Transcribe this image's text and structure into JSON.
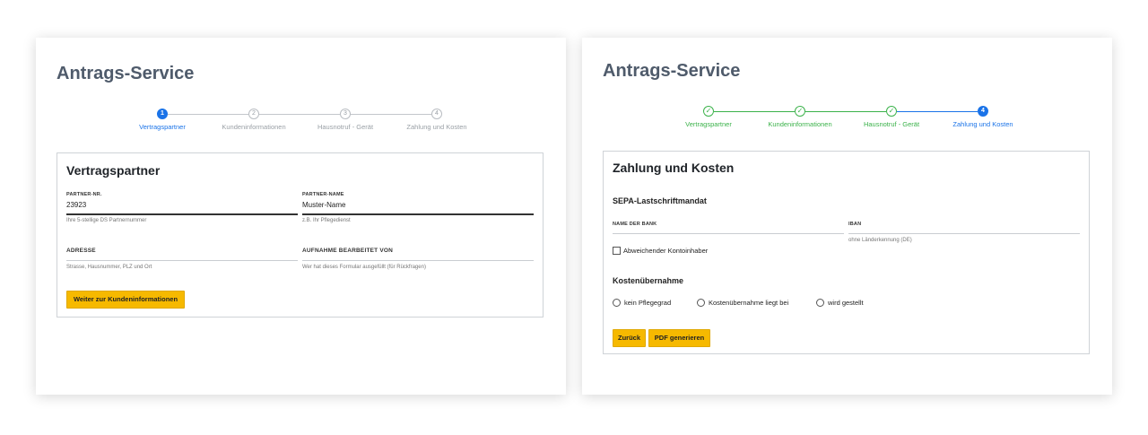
{
  "left_panel": {
    "title": "Antrags-Service",
    "steps": [
      {
        "number": "1",
        "label": "Vertragspartner",
        "state": "active"
      },
      {
        "number": "2",
        "label": "Kundeninformationen",
        "state": "pending"
      },
      {
        "number": "3",
        "label": "Hausnotruf - Gerät",
        "state": "pending"
      },
      {
        "number": "4",
        "label": "Zahlung und Kosten",
        "state": "pending"
      }
    ],
    "card_title": "Vertragspartner",
    "fields": {
      "partner_nr": {
        "label": "PARTNER-NR.",
        "value": "23923",
        "hint": "Ihre 5-stellige DS Partnernummer"
      },
      "partner_name": {
        "label": "PARTNER-NAME",
        "value": "Muster-Name",
        "hint": "z.B. Ihr Pflegedienst"
      },
      "adresse": {
        "label": "ADRESSE",
        "value": "",
        "hint": "Strasse, Hausnummer, PLZ und Ort"
      },
      "bearbeitet_von": {
        "label": "AUFNAHME BEARBEITET VON",
        "value": "",
        "hint": "Wer hat dieses Formular ausgefüllt (für Rückfragen)"
      }
    },
    "next_button": "Weiter zur Kundeninformationen"
  },
  "right_panel": {
    "title": "Antrags-Service",
    "steps": [
      {
        "number": "✓",
        "label": "Vertragspartner",
        "state": "done"
      },
      {
        "number": "✓",
        "label": "Kundeninformationen",
        "state": "done"
      },
      {
        "number": "✓",
        "label": "Hausnotruf - Gerät",
        "state": "done"
      },
      {
        "number": "4",
        "label": "Zahlung und Kosten",
        "state": "active"
      }
    ],
    "card_title": "Zahlung und Kosten",
    "sepa_title": "SEPA-Lastschriftmandat",
    "fields": {
      "bank_name": {
        "label": "NAME DER BANK",
        "value": "",
        "hint": ""
      },
      "iban": {
        "label": "IBAN",
        "value": "",
        "hint": "ohne Länderkennung (DE)"
      }
    },
    "checkbox_label": "Abweichender Kontoinhaber",
    "cost_title": "Kostenübernahme",
    "radio_options": [
      "kein Pflegegrad",
      "Kostenübernahme liegt bei",
      "wird gestellt"
    ],
    "back_button": "Zurück",
    "pdf_button": "PDF generieren"
  },
  "colors": {
    "accent_blue": "#1a73e8",
    "done_green": "#3bb24a",
    "button_yellow": "#f6b900",
    "title_gray": "#4f5b6b"
  }
}
